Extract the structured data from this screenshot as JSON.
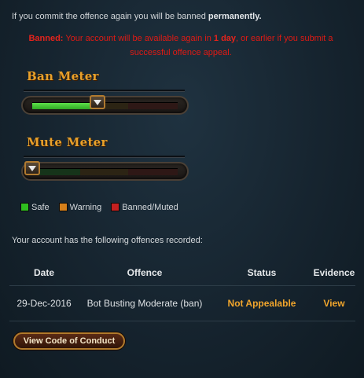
{
  "warning": {
    "prefix": "If you commit the offence again you will be banned ",
    "emphasis": "permanently."
  },
  "ban_notice": {
    "label": "Banned:",
    "text_before": " Your account will be available again in ",
    "duration": "1 day",
    "text_after": ", or earlier if you submit a successful offence appeal."
  },
  "ban_meter": {
    "title": "Ban Meter",
    "level_percent": 45
  },
  "mute_meter": {
    "title": "Mute Meter",
    "level_percent": 0
  },
  "legend": {
    "safe": "Safe",
    "warning": "Warning",
    "banned": "Banned/Muted",
    "colors": {
      "safe": "#2fbf1f",
      "warning": "#d57f1a",
      "banned": "#c52020"
    }
  },
  "offences": {
    "intro": "Your account has the following offences recorded:",
    "headers": {
      "date": "Date",
      "offence": "Offence",
      "status": "Status",
      "evidence": "Evidence"
    },
    "rows": [
      {
        "date": "29-Dec-2016",
        "offence": "Bot Busting Moderate (ban)",
        "status": "Not Appealable",
        "evidence": "View"
      }
    ]
  },
  "buttons": {
    "code_of_conduct": "View Code of Conduct"
  }
}
